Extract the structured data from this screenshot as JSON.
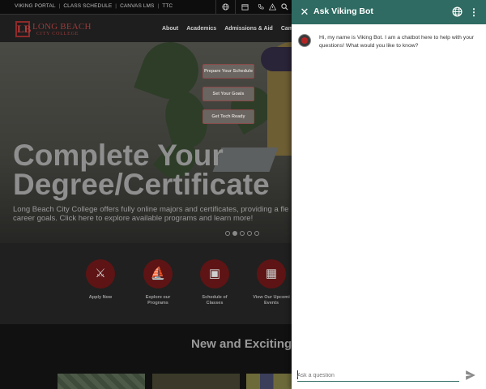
{
  "site": {
    "top_links": [
      "VIKING PORTAL",
      "CLASS SCHEDULE",
      "CANVAS LMS",
      "TTC"
    ],
    "top_icons": [
      "globe-icon",
      "calendar-icon",
      "phone-icon",
      "alert-icon",
      "search-icon"
    ],
    "logo": {
      "line1": "LONG BEACH",
      "line2": "CITY COLLEGE",
      "mark": "LB"
    },
    "nav": [
      "About",
      "Academics",
      "Admissions & Aid",
      "Cam"
    ],
    "hero": {
      "cards": [
        "Prepare Your Schedule",
        "Set Your Goals",
        "Get Tech Ready"
      ],
      "title_line1": "Complete Your",
      "title_line2": "Degree/Certificate",
      "subtitle": "Long Beach City College offers fully online majors and certificates, providing a fle career goals. Click here to explore available programs and learn more!",
      "slides": 5,
      "active_slide": 2
    },
    "quick_links": [
      {
        "label": "Apply Now",
        "icon": "viking-helmet-icon"
      },
      {
        "label": "Explore our Programs",
        "icon": "ship-icon"
      },
      {
        "label": "Schedule of Classes",
        "icon": "laptop-icon"
      },
      {
        "label": "View Our Upcomi Events",
        "icon": "calendar-icon"
      }
    ],
    "section_title": "New and Exciting"
  },
  "chat": {
    "title": "Ask Viking Bot",
    "messages": [
      {
        "from": "bot",
        "text": "Hi, my name is Viking Bot. I am a chatbot here to help with your questions! What would you like to know?"
      }
    ],
    "input": {
      "value": "",
      "placeholder": "Ask a question"
    },
    "colors": {
      "header": "#2f6b62"
    }
  }
}
